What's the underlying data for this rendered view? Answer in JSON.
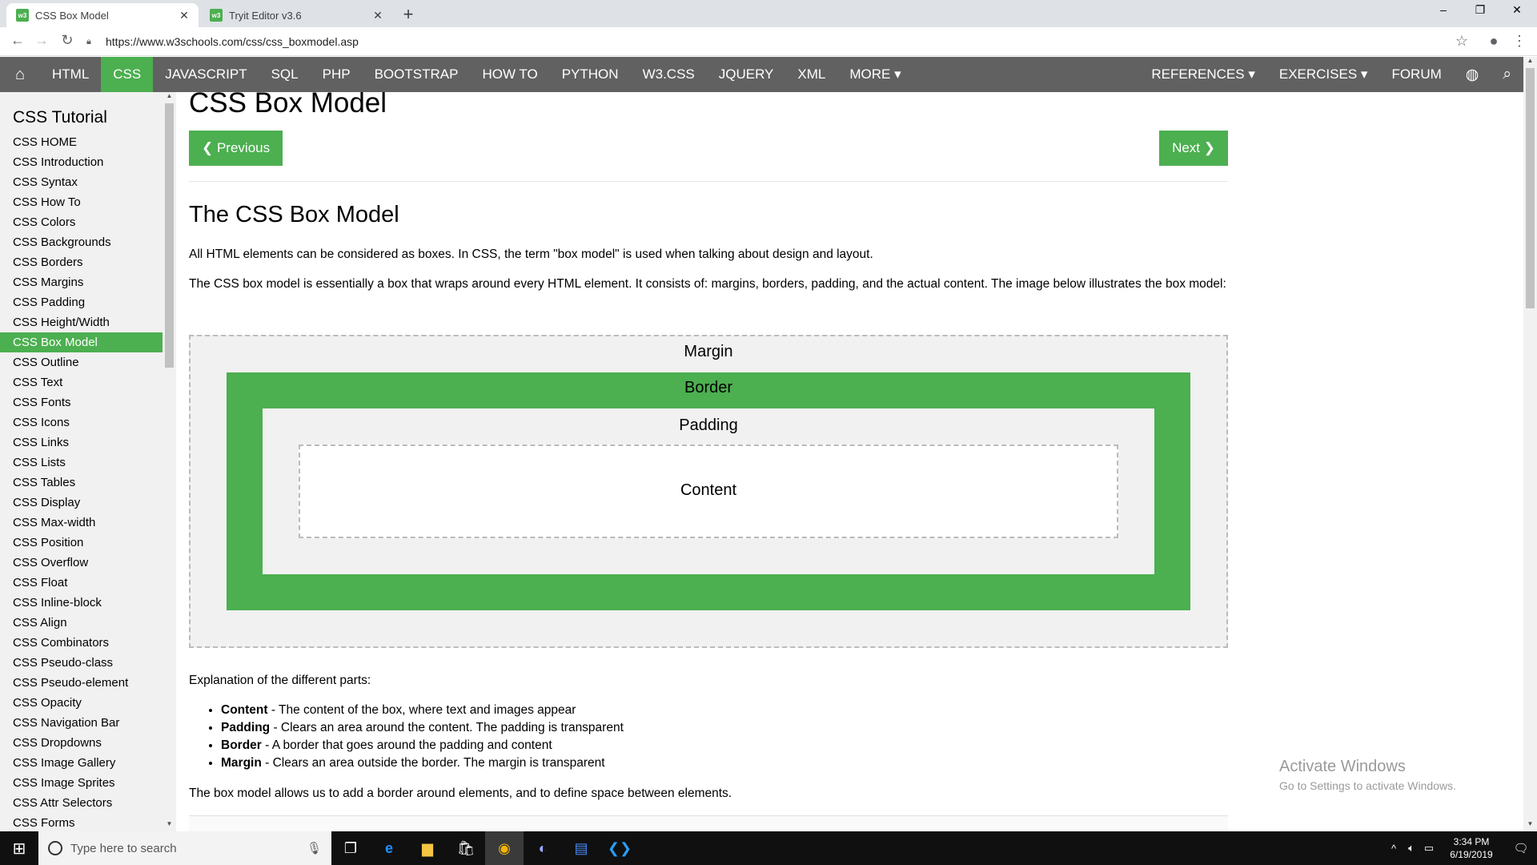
{
  "browser": {
    "tabs": [
      {
        "title": "CSS Box Model",
        "favicon": "w3s",
        "active": true
      },
      {
        "title": "Tryit Editor v3.6",
        "favicon": "w3s",
        "active": false
      }
    ],
    "new_tab": "+",
    "url": "https://www.w3schools.com/css/css_boxmodel.asp",
    "window_controls": {
      "minimize": "–",
      "restore": "❐",
      "close": "✕"
    }
  },
  "topnav": {
    "items": [
      {
        "label": "HTML"
      },
      {
        "label": "CSS",
        "active": true
      },
      {
        "label": "JAVASCRIPT"
      },
      {
        "label": "SQL"
      },
      {
        "label": "PHP"
      },
      {
        "label": "BOOTSTRAP"
      },
      {
        "label": "HOW TO"
      },
      {
        "label": "PYTHON"
      },
      {
        "label": "W3.CSS"
      },
      {
        "label": "JQUERY"
      },
      {
        "label": "XML"
      },
      {
        "label": "MORE ▾"
      }
    ],
    "right_items": [
      {
        "label": "REFERENCES ▾"
      },
      {
        "label": "EXERCISES ▾"
      },
      {
        "label": "FORUM"
      }
    ],
    "accent_color": "#4CAF50",
    "bar_color": "#616161"
  },
  "sidebar": {
    "title": "CSS Tutorial",
    "items": [
      "CSS HOME",
      "CSS Introduction",
      "CSS Syntax",
      "CSS How To",
      "CSS Colors",
      "CSS Backgrounds",
      "CSS Borders",
      "CSS Margins",
      "CSS Padding",
      "CSS Height/Width",
      "CSS Box Model",
      "CSS Outline",
      "CSS Text",
      "CSS Fonts",
      "CSS Icons",
      "CSS Links",
      "CSS Lists",
      "CSS Tables",
      "CSS Display",
      "CSS Max-width",
      "CSS Position",
      "CSS Overflow",
      "CSS Float",
      "CSS Inline-block",
      "CSS Align",
      "CSS Combinators",
      "CSS Pseudo-class",
      "CSS Pseudo-element",
      "CSS Opacity",
      "CSS Navigation Bar",
      "CSS Dropdowns",
      "CSS Image Gallery",
      "CSS Image Sprites",
      "CSS Attr Selectors",
      "CSS Forms"
    ],
    "active_item": "CSS Box Model"
  },
  "main": {
    "page_title": "CSS Box Model",
    "prev_label": "❮ Previous",
    "next_label": "Next ❯",
    "section_title": "The CSS Box Model",
    "para1": "All HTML elements can be considered as boxes. In CSS, the term \"box model\" is used when talking about design and layout.",
    "para2": "The CSS box model is essentially a box that wraps around every HTML element. It consists of: margins, borders, padding, and the actual content. The image below illustrates the box model:",
    "diagram": {
      "margin": "Margin",
      "border": "Border",
      "padding": "Padding",
      "content": "Content"
    },
    "explain_intro": "Explanation of the different parts:",
    "parts": [
      {
        "term": "Content",
        "desc": " - The content of the box, where text and images appear"
      },
      {
        "term": "Padding",
        "desc": " - Clears an area around the content. The padding is transparent"
      },
      {
        "term": "Border",
        "desc": " - A border that goes around the padding and content"
      },
      {
        "term": "Margin",
        "desc": " - Clears an area outside the border. The margin is transparent"
      }
    ],
    "para_last": "The box model allows us to add a border around elements, and to define space between elements."
  },
  "watermark": {
    "title": "Activate Windows",
    "subtitle": "Go to Settings to activate Windows."
  },
  "taskbar": {
    "search_placeholder": "Type here to search",
    "time": "3:34 PM",
    "date": "6/19/2019"
  }
}
